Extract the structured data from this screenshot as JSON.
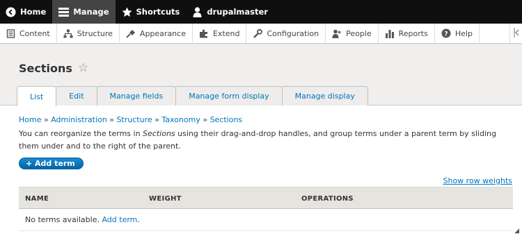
{
  "toolbar": {
    "home_label": "Home",
    "manage_label": "Manage",
    "shortcuts_label": "Shortcuts",
    "user_label": "drupalmaster"
  },
  "tray": {
    "items": [
      {
        "label": "Content",
        "icon": "content-icon"
      },
      {
        "label": "Structure",
        "icon": "structure-icon"
      },
      {
        "label": "Appearance",
        "icon": "appearance-icon"
      },
      {
        "label": "Extend",
        "icon": "extend-icon"
      },
      {
        "label": "Configuration",
        "icon": "configuration-icon"
      },
      {
        "label": "People",
        "icon": "people-icon"
      },
      {
        "label": "Reports",
        "icon": "reports-icon"
      },
      {
        "label": "Help",
        "icon": "help-icon"
      }
    ]
  },
  "header": {
    "title": "Sections",
    "tabs": [
      "List",
      "Edit",
      "Manage fields",
      "Manage form display",
      "Manage display"
    ]
  },
  "breadcrumb": {
    "items": [
      "Home",
      "Administration",
      "Structure",
      "Taxonomy",
      "Sections"
    ],
    "separator": "»"
  },
  "help": {
    "before": "You can reorganize the terms in ",
    "em": "Sections",
    "after": " using their drag-and-drop handles, and group terms under a parent term by sliding them under and to the right of the parent."
  },
  "actions": {
    "add_term": "+ Add term",
    "show_row_weights": "Show row weights"
  },
  "table": {
    "headers": [
      "NAME",
      "WEIGHT",
      "OPERATIONS"
    ],
    "empty_text": "No terms available.",
    "empty_link": "Add term",
    "empty_tail": "."
  },
  "colors": {
    "toolbar_bg": "#0f0f0f",
    "link": "#0074bd",
    "primary_button": "#0072b9"
  }
}
